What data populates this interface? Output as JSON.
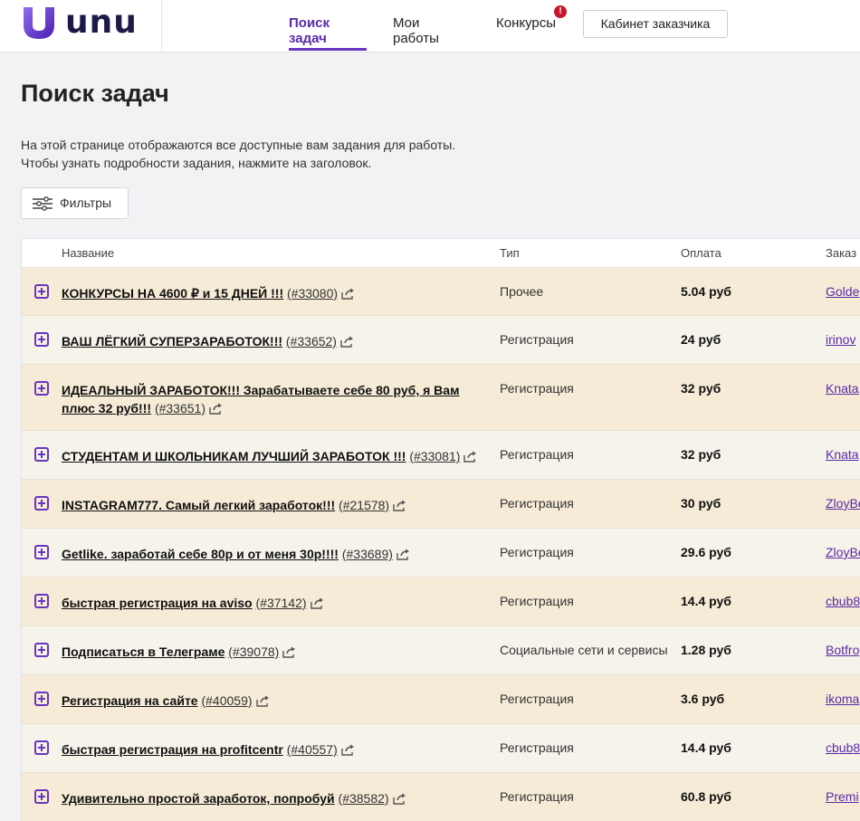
{
  "header": {
    "logo_text": "unu",
    "nav": [
      {
        "label": "Поиск задач",
        "active": true
      },
      {
        "label": "Мои работы",
        "active": false
      },
      {
        "label": "Конкурсы",
        "active": false
      }
    ],
    "contest_badge": "!",
    "cabinet_button": "Кабинет заказчика",
    "accent_color": "#6a35c2"
  },
  "page": {
    "title": "Поиск задач",
    "intro_line1": "На этой странице отображаются все доступные вам задания для работы.",
    "intro_line2": "Чтобы узнать подробности задания, нажмите на заголовок.",
    "filters_button": "Фильтры"
  },
  "table": {
    "headers": {
      "name": "Название",
      "type": "Тип",
      "pay": "Оплата",
      "customer": "Заказ"
    },
    "rows": [
      {
        "title": "КОНКУРСЫ НА 4600 ₽ и 15 ДНЕЙ !!!",
        "id": "(#33080)",
        "type": "Прочее",
        "pay": "5.04 руб",
        "customer": "Golde"
      },
      {
        "title": "ВАШ ЛЁГКИЙ СУПЕРЗАРАБОТОК!!!",
        "id": "(#33652)",
        "type": "Регистрация",
        "pay": "24 руб",
        "customer": "irinov"
      },
      {
        "title": "ИДЕАЛЬНЫЙ ЗАРАБОТОК!!! Зарабатываете себе 80 руб, я Вам плюс 32 руб!!!",
        "id": "(#33651)",
        "type": "Регистрация",
        "pay": "32 руб",
        "customer": "Knata"
      },
      {
        "title": "СТУДЕНТАМ И ШКОЛЬНИКАМ ЛУЧШИЙ ЗАРАБОТОК !!!",
        "id": "(#33081)",
        "type": "Регистрация",
        "pay": "32 руб",
        "customer": "Knata"
      },
      {
        "title": "INSTAGRAM777. Самый легкий заработок!!!",
        "id": "(#21578)",
        "type": "Регистрация",
        "pay": "30 руб",
        "customer": "ZloyBe"
      },
      {
        "title": "Getlike. заработай себе 80р и от меня 30р!!!!",
        "id": "(#33689)",
        "type": "Регистрация",
        "pay": "29.6 руб",
        "customer": "ZloyBe"
      },
      {
        "title": "быстрая регистрация на aviso",
        "id": "(#37142)",
        "type": "Регистрация",
        "pay": "14.4 руб",
        "customer": "cbub8"
      },
      {
        "title": "Подписаться в Телеграме",
        "id": "(#39078)",
        "type": "Социальные сети и сервисы",
        "pay": "1.28 руб",
        "customer": "Botfro"
      },
      {
        "title": "Регистрация на сайте",
        "id": "(#40059)",
        "type": "Регистрация",
        "pay": "3.6 руб",
        "customer": "ikoma"
      },
      {
        "title": "быстрая регистрация на profitcentr",
        "id": "(#40557)",
        "type": "Регистрация",
        "pay": "14.4 руб",
        "customer": "cbub8"
      },
      {
        "title": "Удивительно простой заработок, попробуй",
        "id": "(#38582)",
        "type": "Регистрация",
        "pay": "60.8 руб",
        "customer": "Premi"
      }
    ]
  }
}
